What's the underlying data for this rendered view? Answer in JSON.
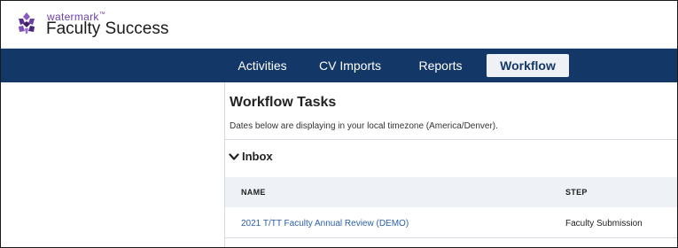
{
  "brand": {
    "company": "watermark",
    "trademark": "™",
    "product": "Faculty Success",
    "accent_color": "#6d3fa6",
    "logo_icon": "watermark-logo-icon"
  },
  "nav": {
    "background": "#133867",
    "items": [
      {
        "label": "Activities",
        "active": false
      },
      {
        "label": "CV Imports",
        "active": false
      },
      {
        "label": "Reports",
        "active": false
      },
      {
        "label": "Workflow",
        "active": true
      }
    ]
  },
  "main": {
    "title": "Workflow Tasks",
    "timezone_note": "Dates below are displaying in your local timezone (America/Denver).",
    "inbox": {
      "label": "Inbox",
      "icon": "chevron-down-icon",
      "columns": [
        "NAME",
        "STEP"
      ],
      "rows": [
        {
          "name": "2021 T/TT Faculty Annual Review (DEMO)",
          "step": "Faculty Submission"
        }
      ]
    }
  }
}
